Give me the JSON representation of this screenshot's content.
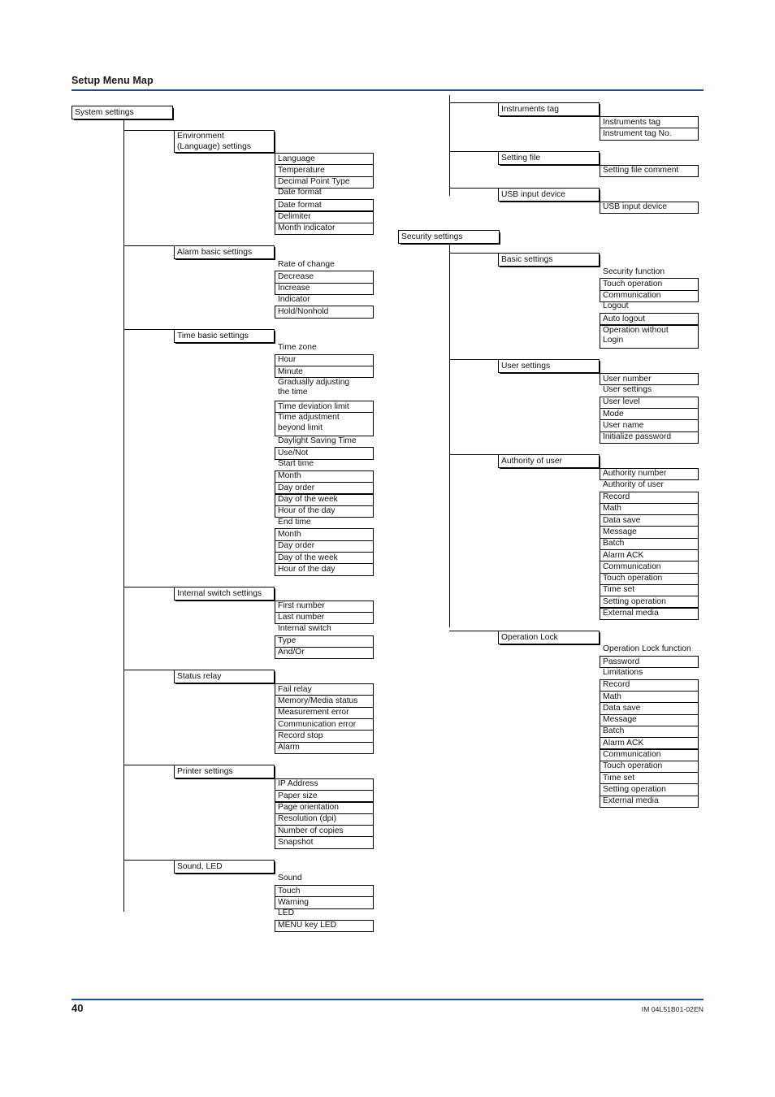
{
  "header": {
    "title": "Setup Menu Map"
  },
  "footer": {
    "page_number": "40",
    "doc_code": "IM 04L51B01-02EN"
  },
  "colors": {
    "rule_blue": "#1B4E94",
    "box_border": "#000000",
    "text": "#111111",
    "background": "#FFFFFF"
  },
  "left_column": {
    "root": "System settings",
    "groups": [
      {
        "title": "Environment\n(Language) settings",
        "rows": [
          {
            "label": "Language",
            "boxed": true
          },
          {
            "label": "Temperature",
            "boxed": true
          },
          {
            "label": "Decimal Point Type",
            "boxed": true
          },
          {
            "label": "Date format",
            "boxed": false
          },
          {
            "label": "Date format",
            "boxed": true
          },
          {
            "label": "Delimiter",
            "boxed": true
          },
          {
            "label": "Month indicator",
            "boxed": true
          }
        ]
      },
      {
        "title": "Alarm basic settings",
        "rows": [
          {
            "label": "Rate of change",
            "boxed": false
          },
          {
            "label": "Decrease",
            "boxed": true
          },
          {
            "label": "Increase",
            "boxed": true
          },
          {
            "label": "Indicator",
            "boxed": false
          },
          {
            "label": "Hold/Nonhold",
            "boxed": true
          }
        ]
      },
      {
        "title": "Time basic settings",
        "rows": [
          {
            "label": "Time zone",
            "boxed": false
          },
          {
            "label": "Hour",
            "boxed": true
          },
          {
            "label": "Minute",
            "boxed": true
          },
          {
            "label": "Gradually adjusting\nthe time",
            "boxed": false
          },
          {
            "label": "Time deviation limit",
            "boxed": true
          },
          {
            "label": "Time adjustment\nbeyond limit",
            "boxed": true
          },
          {
            "label": "Daylight Saving Time",
            "boxed": false
          },
          {
            "label": "Use/Not",
            "boxed": true
          },
          {
            "label": "Start time",
            "boxed": false
          },
          {
            "label": "Month",
            "boxed": true
          },
          {
            "label": "Day order",
            "boxed": true
          },
          {
            "label": "Day of the week",
            "boxed": true
          },
          {
            "label": "Hour of the day",
            "boxed": true
          },
          {
            "label": "End time",
            "boxed": false
          },
          {
            "label": "Month",
            "boxed": true
          },
          {
            "label": "Day order",
            "boxed": true
          },
          {
            "label": "Day of the week",
            "boxed": true
          },
          {
            "label": "Hour of the day",
            "boxed": true
          }
        ]
      },
      {
        "title": "Internal switch settings",
        "rows": [
          {
            "label": "First number",
            "boxed": true
          },
          {
            "label": "Last number",
            "boxed": true
          },
          {
            "label": "Internal switch",
            "boxed": false
          },
          {
            "label": "Type",
            "boxed": true
          },
          {
            "label": "And/Or",
            "boxed": true
          }
        ]
      },
      {
        "title": "Status relay",
        "rows": [
          {
            "label": "Fail relay",
            "boxed": true
          },
          {
            "label": "Memory/Media status",
            "boxed": true
          },
          {
            "label": "Measurement error",
            "boxed": true
          },
          {
            "label": "Communication error",
            "boxed": true
          },
          {
            "label": "Record stop",
            "boxed": true
          },
          {
            "label": "Alarm",
            "boxed": true
          }
        ]
      },
      {
        "title": "Printer settings",
        "rows": [
          {
            "label": "IP Address",
            "boxed": true
          },
          {
            "label": "Paper size",
            "boxed": true
          },
          {
            "label": "Page orientation",
            "boxed": true
          },
          {
            "label": "Resolution (dpi)",
            "boxed": true
          },
          {
            "label": "Number of copies",
            "boxed": true
          },
          {
            "label": "Snapshot",
            "boxed": true
          }
        ]
      },
      {
        "title": "Sound, LED",
        "rows": [
          {
            "label": "Sound",
            "boxed": false
          },
          {
            "label": "Touch",
            "boxed": true
          },
          {
            "label": "Warning",
            "boxed": true
          },
          {
            "label": "LED",
            "boxed": false
          },
          {
            "label": "MENU key LED",
            "boxed": true
          }
        ]
      }
    ]
  },
  "right_column_top": {
    "groups": [
      {
        "title": "Instruments tag",
        "rows": [
          {
            "label": "Instruments tag",
            "boxed": true
          },
          {
            "label": "Instrument tag No.",
            "boxed": true
          }
        ]
      },
      {
        "title": "Setting file",
        "rows": [
          {
            "label": "Setting file comment",
            "boxed": true
          }
        ]
      },
      {
        "title": "USB input device",
        "rows": [
          {
            "label": "USB input device",
            "boxed": true
          }
        ]
      }
    ]
  },
  "right_column_security": {
    "root": "Security settings",
    "groups": [
      {
        "title": "Basic settings",
        "rows": [
          {
            "label": "Security function",
            "boxed": false
          },
          {
            "label": "Touch operation",
            "boxed": true
          },
          {
            "label": "Communication",
            "boxed": true
          },
          {
            "label": "Logout",
            "boxed": false
          },
          {
            "label": "Auto logout",
            "boxed": true
          },
          {
            "label": "Operation without\nLogin",
            "boxed": true
          }
        ]
      },
      {
        "title": "User settings",
        "rows": [
          {
            "label": "User number",
            "boxed": true
          },
          {
            "label": "User settings",
            "boxed": false
          },
          {
            "label": "User level",
            "boxed": true
          },
          {
            "label": "Mode",
            "boxed": true
          },
          {
            "label": "User name",
            "boxed": true
          },
          {
            "label": "Initialize password",
            "boxed": true
          }
        ]
      },
      {
        "title": "Authority of user",
        "rows": [
          {
            "label": "Authority number",
            "boxed": true
          },
          {
            "label": "Authority of user",
            "boxed": false
          },
          {
            "label": "Record",
            "boxed": true
          },
          {
            "label": "Math",
            "boxed": true
          },
          {
            "label": "Data save",
            "boxed": true
          },
          {
            "label": "Message",
            "boxed": true
          },
          {
            "label": "Batch",
            "boxed": true
          },
          {
            "label": "Alarm ACK",
            "boxed": true
          },
          {
            "label": "Communication",
            "boxed": true
          },
          {
            "label": "Touch operation",
            "boxed": true
          },
          {
            "label": "Time set",
            "boxed": true
          },
          {
            "label": "Setting operation",
            "boxed": true
          },
          {
            "label": "External media",
            "boxed": true
          }
        ]
      },
      {
        "title": "Operation Lock",
        "rows": [
          {
            "label": "Operation Lock function",
            "boxed": false
          },
          {
            "label": "Password",
            "boxed": true
          },
          {
            "label": "Limitations",
            "boxed": false
          },
          {
            "label": "Record",
            "boxed": true
          },
          {
            "label": "Math",
            "boxed": true
          },
          {
            "label": "Data save",
            "boxed": true
          },
          {
            "label": "Message",
            "boxed": true
          },
          {
            "label": "Batch",
            "boxed": true
          },
          {
            "label": "Alarm ACK",
            "boxed": true
          },
          {
            "label": "Communication",
            "boxed": true
          },
          {
            "label": "Touch operation",
            "boxed": true
          },
          {
            "label": "Time set",
            "boxed": true
          },
          {
            "label": "Setting operation",
            "boxed": true
          },
          {
            "label": "External media",
            "boxed": true
          }
        ]
      }
    ]
  }
}
